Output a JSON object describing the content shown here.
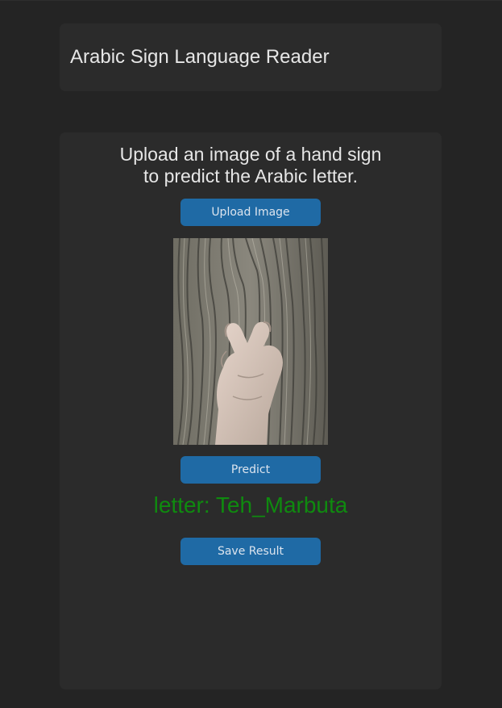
{
  "header": {
    "title": "Arabic Sign Language Reader"
  },
  "main": {
    "instruction_line1": "Upload an image of a hand sign",
    "instruction_line2": "to predict the Arabic letter.",
    "upload_label": "Upload Image",
    "predict_label": "Predict",
    "result_text": "letter: Teh_Marbuta",
    "save_label": "Save Result"
  },
  "colors": {
    "background": "#242424",
    "panel": "#2b2b2b",
    "button": "#1f6aa5",
    "result_text": "#0f8a0f"
  },
  "preview_image": {
    "icon": "hand-sign-photo"
  }
}
